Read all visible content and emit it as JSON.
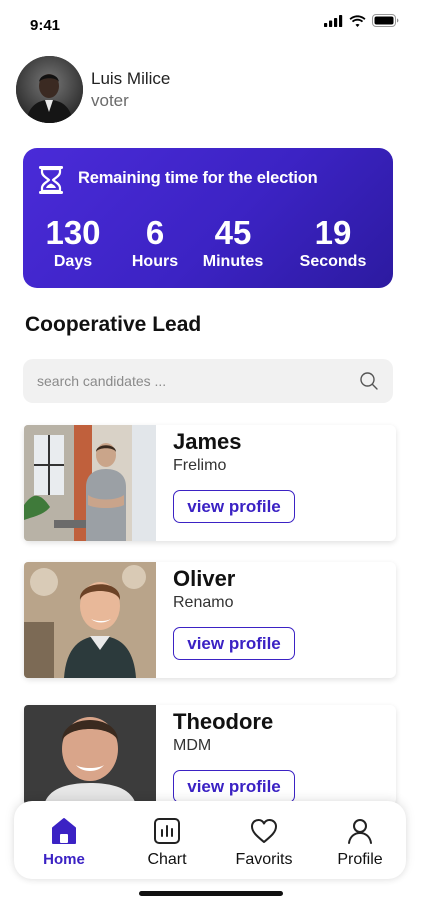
{
  "status_bar": {
    "time": "9:41"
  },
  "user": {
    "name": "Luis Milice",
    "role": "voter"
  },
  "countdown": {
    "title": "Remaining time for the election",
    "units": [
      {
        "value": "130",
        "label": "Days"
      },
      {
        "value": "6",
        "label": "Hours"
      },
      {
        "value": "45",
        "label": "Minutes"
      },
      {
        "value": "19",
        "label": "Seconds"
      }
    ]
  },
  "section": {
    "title": "Cooperative Lead"
  },
  "search": {
    "placeholder": "search candidates ..."
  },
  "candidates": [
    {
      "name": "James",
      "party": "Frelimo",
      "button_label": "view profile"
    },
    {
      "name": "Oliver",
      "party": "Renamo",
      "button_label": "view profile"
    },
    {
      "name": "Theodore",
      "party": "MDM",
      "button_label": "view profile"
    }
  ],
  "nav": {
    "items": [
      {
        "label": "Home",
        "icon": "home-icon",
        "active": true
      },
      {
        "label": "Chart",
        "icon": "chart-icon",
        "active": false
      },
      {
        "label": "Favorits",
        "icon": "heart-icon",
        "active": false
      },
      {
        "label": "Profile",
        "icon": "user-icon",
        "active": false
      }
    ]
  },
  "colors": {
    "accent": "#3b22c4",
    "card_gradient_start": "#4a2bd8",
    "card_gradient_end": "#2c1aa0",
    "search_bg": "#f1f1f1"
  }
}
